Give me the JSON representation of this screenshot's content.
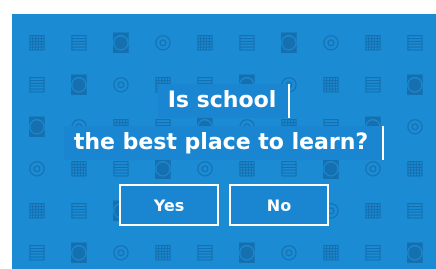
{
  "dialog": {
    "question_line_1": "Is school",
    "question_line_2": "the best place to learn?"
  },
  "buttons": {
    "yes_label": "Yes",
    "no_label": "No"
  },
  "pattern": {
    "icons": [
      "calculator-icon",
      "book-icon",
      "school-bag-icon",
      "glasses-icon"
    ]
  },
  "colors": {
    "background": "#1b8bd4",
    "pattern_icon": "#166fae",
    "panel": "#1a86d2",
    "text": "#ffffff"
  }
}
